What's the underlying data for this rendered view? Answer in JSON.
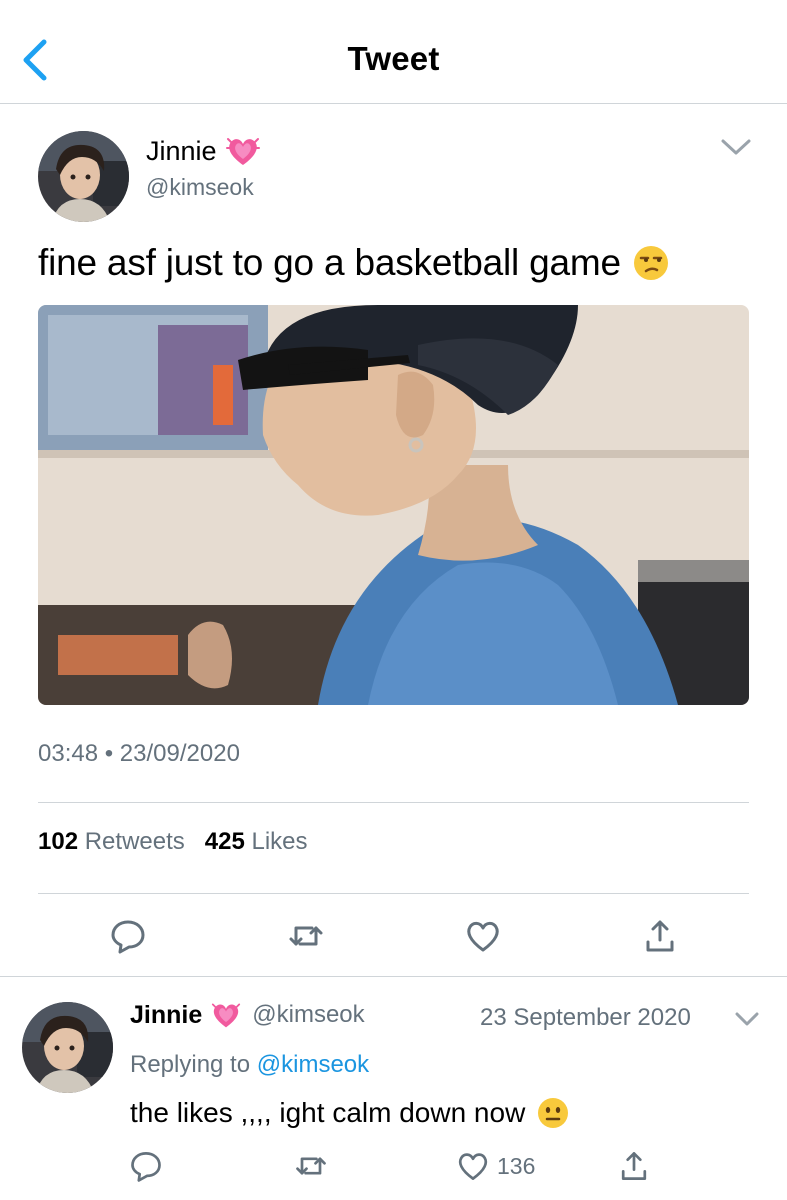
{
  "header": {
    "title": "Tweet",
    "back_icon": "chevron-left-icon",
    "accent": "#1da1f2"
  },
  "tweet": {
    "author_name": "Jinnie",
    "author_handle": "@kimseok",
    "name_emoji": "growing-heart-icon",
    "text": "fine asf just to go a basketball game",
    "text_emoji": "unamused-face-icon",
    "timestamp": "03:48 • 23/09/2020",
    "retweets_count": "102",
    "retweets_label": "Retweets",
    "likes_count": "425",
    "likes_label": "Likes",
    "media": "photo of person in cap and sunglasses"
  },
  "actions": [
    "reply-icon",
    "retweet-icon",
    "like-icon",
    "share-icon"
  ],
  "reply": {
    "author_name": "Jinnie",
    "author_handle": "@kimseok",
    "date": "23 September 2020",
    "replying_prefix": "Replying to",
    "replying_to": "@kimseok",
    "text": "the likes ,,,, ight calm down now",
    "text_emoji": "neutral-face-icon",
    "like_count": "136"
  },
  "colors": {
    "secondary_text": "#64717c",
    "link": "#1b95e0",
    "divider": "#d0d5d9"
  }
}
